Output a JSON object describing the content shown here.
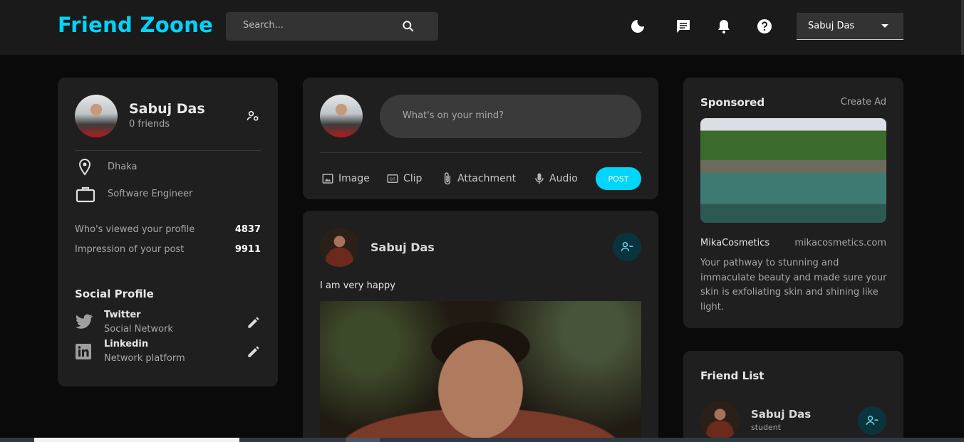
{
  "header": {
    "logo": "Friend Zoone",
    "search_placeholder": "Search...",
    "user_name": "Sabuj Das"
  },
  "profile": {
    "name": "Sabuj Das",
    "friends": "0 friends",
    "location": "Dhaka",
    "occupation": "Software Engineer",
    "stats": [
      {
        "label": "Who's viewed your profile",
        "value": "4837"
      },
      {
        "label": "Impression of your post",
        "value": "9911"
      }
    ],
    "social_title": "Social Profile",
    "social": [
      {
        "name": "Twitter",
        "desc": "Social Network"
      },
      {
        "name": "Linkedin",
        "desc": "Network platform"
      }
    ]
  },
  "share": {
    "placeholder": "What's on your mind?",
    "actions": [
      "Image",
      "Clip",
      "Attachment",
      "Audio"
    ],
    "post_label": "POST"
  },
  "feed": {
    "post": {
      "author": "Sabuj Das",
      "text": "I am very happy"
    }
  },
  "sponsored": {
    "title": "Sponsored",
    "create_ad": "Create Ad",
    "brand": "MikaCosmetics",
    "site": "mikacosmetics.com",
    "description": "Your pathway to stunning and immaculate beauty and made sure your skin is exfoliating skin and shining like light."
  },
  "friend_list": {
    "title": "Friend List",
    "friends": [
      {
        "name": "Sabuj Das",
        "role": "student"
      }
    ]
  },
  "colors": {
    "accent": "#00d5fa",
    "card": "#1f1f1f",
    "background": "#0a0a0a"
  }
}
